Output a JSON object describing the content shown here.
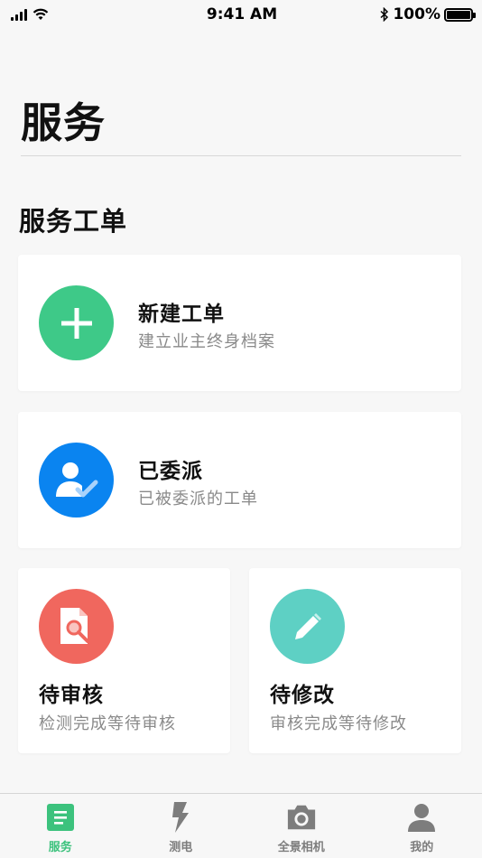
{
  "status_bar": {
    "time": "9:41 AM",
    "battery": "100%"
  },
  "page": {
    "title": "服务",
    "section_title": "服务工单"
  },
  "cards": {
    "new_order": {
      "title": "新建工单",
      "subtitle": "建立业主终身档案",
      "icon": "plus-icon",
      "color": "#3ec988"
    },
    "assigned": {
      "title": "已委派",
      "subtitle": "已被委派的工单",
      "icon": "user-check-icon",
      "color": "#0a84f0"
    },
    "pending_review": {
      "title": "待审核",
      "subtitle": "检测完成等待审核",
      "icon": "document-search-icon",
      "color": "#f0675e"
    },
    "pending_modify": {
      "title": "待修改",
      "subtitle": "审核完成等待修改",
      "icon": "pencil-icon",
      "color": "#5ed0c4"
    }
  },
  "tab_bar": {
    "active_color": "#3cc27d",
    "inactive_color": "#7d7d7d",
    "tabs": [
      {
        "label": "服务",
        "icon": "service-list-icon",
        "active": true
      },
      {
        "label": "测电",
        "icon": "lightning-icon",
        "active": false
      },
      {
        "label": "全景相机",
        "icon": "camera-icon",
        "active": false
      },
      {
        "label": "我的",
        "icon": "person-icon",
        "active": false
      }
    ]
  }
}
